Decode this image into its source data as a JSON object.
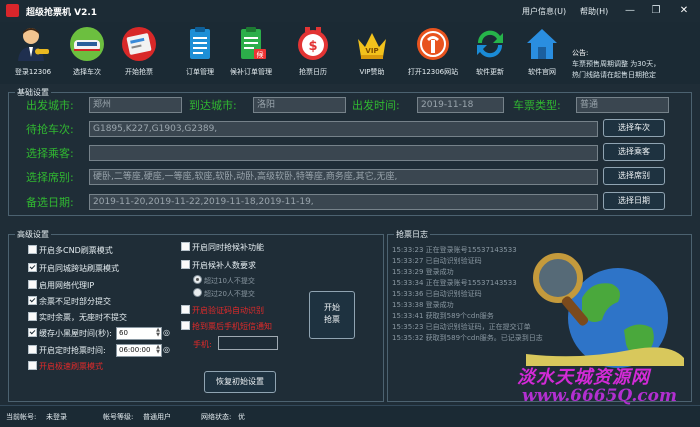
{
  "titlebar": {
    "title": "超级抢票机 V2.1",
    "user_info": "用户信息(U)",
    "help": "帮助(H)",
    "minimize": "—",
    "restore": "❐",
    "close": "✕"
  },
  "toolbar": {
    "items": [
      {
        "label": "登录12306",
        "icon": "user-login-icon"
      },
      {
        "label": "选择车次",
        "icon": "train-icon"
      },
      {
        "label": "开始抢票",
        "icon": "ticket-icon"
      },
      {
        "label": "订单管理",
        "icon": "order-list-icon"
      },
      {
        "label": "候补订单管理",
        "icon": "waitlist-order-icon"
      },
      {
        "label": "抢票日历",
        "icon": "calendar-clock-icon"
      },
      {
        "label": "VIP赞助",
        "icon": "vip-crown-icon"
      },
      {
        "label": "打开12306网站",
        "icon": "railway-logo-icon"
      },
      {
        "label": "软件更新",
        "icon": "update-icon"
      },
      {
        "label": "软件官网",
        "icon": "home-icon"
      }
    ]
  },
  "notice": {
    "title": "公告:",
    "lines": [
      "车票预售周期调整 为30天，",
      "热门线路请在起售日期抢定"
    ]
  },
  "basic": {
    "title": "基础设置",
    "from_label": "出发城市:",
    "from_value": "郑州",
    "to_label": "到达城市:",
    "to_value": "洛阳",
    "date_label": "出发时间:",
    "date_value": "2019-11-18",
    "type_label": "车票类型:",
    "type_value": "普通",
    "trains_label": "待抢车次:",
    "trains_value": "G1895,K227,G1903,G2389,",
    "trains_button": "选择车次",
    "passenger_label": "选择乘客:",
    "passenger_value": "",
    "passenger_button": "选择乘客",
    "seat_label": "选择席别:",
    "seat_value": "硬卧,二等座,硬座,一等座,软座,软卧,动卧,高级软卧,特等座,商务座,其它,无座,",
    "seat_button": "选择席别",
    "backup_label": "备选日期:",
    "backup_value": "2019-11-20,2019-11-22,2019-11-18,2019-11-19,",
    "backup_button": "选择日期"
  },
  "advanced": {
    "title": "高级设置",
    "left_options": [
      {
        "label": "开启多CND刷票模式",
        "checked": false
      },
      {
        "label": "开启同城跨站刷票模式",
        "checked": true
      },
      {
        "label": "启用网络代理IP",
        "checked": false
      },
      {
        "label": "余票不足时部分提交",
        "checked": true
      },
      {
        "label": "实时余票，无座时不提交",
        "checked": false
      }
    ],
    "interval_label": "缓存小黑屋时间(秒):",
    "interval_value": "60",
    "timer_label": "开启定时抢票时间:",
    "timer_value": "06:00:00",
    "fast_mode": "开启极速刷票模式",
    "right_options": [
      {
        "label": "开启同时抢候补功能",
        "checked": false
      },
      {
        "label": "开启候补人数要求",
        "checked": false
      }
    ],
    "radio_options": [
      {
        "label": "超过10人不提交",
        "selected": true
      },
      {
        "label": "超过20人不提交",
        "selected": false
      }
    ],
    "red_options": [
      {
        "label": "开启验证码自动识别",
        "checked": false
      },
      {
        "label": "抢到票后手机短信通知",
        "checked": false
      }
    ],
    "phone_label": "手机:",
    "phone_value": "",
    "start_button_line1": "开始",
    "start_button_line2": "抢票",
    "reset_button": "恢复初始设置"
  },
  "log": {
    "title": "抢票日志",
    "lines": [
      "15:33:23 正在登录账号15537143533",
      "15:33:27 已自动识别验证码",
      "15:33:29 登录成功",
      "15:33:34 正在登录账号15537143533",
      "15:33:36 已自动识别验证码",
      "15:33:38 登录成功",
      "15:33:41 获取到589个cdn服务",
      "15:35:23 已自动识别验证码，正在提交订单",
      "15:35:32 获取到589个cdn服务。已记录到日志"
    ]
  },
  "statusbar": {
    "account_label": "当前帐号:",
    "account_value": "未登录",
    "level_label": "帐号等级:",
    "level_value": "普通用户",
    "network_label": "网络状态:",
    "network_value": "优"
  },
  "watermark": {
    "text": "淡水天城资源网",
    "url": "www.6665Q.com"
  }
}
